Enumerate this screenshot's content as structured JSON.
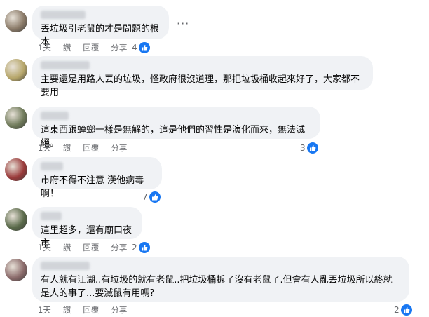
{
  "comments": [
    {
      "text": "丟垃圾引老鼠的才是問題的根本",
      "time": "1天",
      "like": "讚",
      "reply": "回覆",
      "share": "分享",
      "reactions": "4",
      "avatar_color": "#8a7a68"
    },
    {
      "text": "主要還是用路人丟的垃圾，怪政府很沒道理，那把垃圾桶收起來好了，大家都不要用",
      "time": "1天",
      "like": "讚",
      "reply": "回覆",
      "share": "分享",
      "reactions": "",
      "avatar_color": "#b6a66a"
    },
    {
      "text": "這東西跟蟑螂一樣是無解的，這是他們的習性是演化而來，無法滅絕。",
      "time": "1天",
      "like": "讚",
      "reply": "回覆",
      "share": "分享",
      "reactions": "3",
      "avatar_color": "#6f7a5a"
    },
    {
      "text": "市府不得不注意 漢他病毒啊！",
      "time": "1天",
      "like": "讚",
      "reply": "回覆",
      "share": "分享",
      "reactions": "7",
      "avatar_color": "#9a3a3a"
    },
    {
      "text": "這里超多，還有廟口夜市",
      "time": "1天",
      "like": "讚",
      "reply": "回覆",
      "share": "分享",
      "reactions": "2",
      "avatar_color": "#5a6a4a"
    },
    {
      "text": "有人就有江湖..有垃圾的就有老鼠..把垃圾桶拆了沒有老鼠了.但會有人亂丟垃圾所以終就是人的事了...要滅鼠有用嗎?",
      "time": "1天",
      "like": "讚",
      "reply": "回覆",
      "share": "分享",
      "reactions": "2",
      "avatar_color": "#8a6a6a"
    }
  ],
  "icons": {
    "like": "like-thumb-icon",
    "more": "more-options-icon"
  },
  "colors": {
    "bubble": "#f0f2f5",
    "like_blue": "#1877f2",
    "meta_gray": "#65676b"
  }
}
